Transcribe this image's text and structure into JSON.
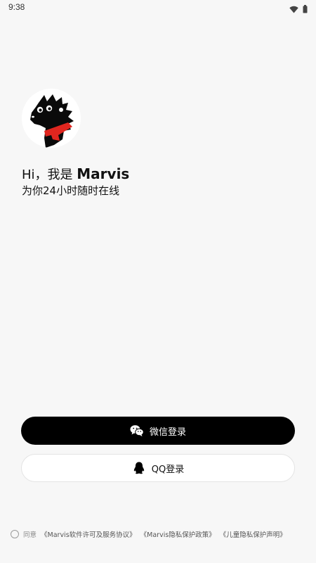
{
  "status_bar": {
    "time": "9:38",
    "icons": [
      "wifi-icon",
      "battery-icon"
    ]
  },
  "welcome": {
    "greeting_prefix": "Hi，我是 ",
    "brand": "Marvis",
    "subtitle": "为你24小时随时在线"
  },
  "login": {
    "wechat_label": "微信登录",
    "qq_label": "QQ登录"
  },
  "agreement": {
    "prefix": "同意",
    "links": [
      "《Marvis软件许可及服务协议》",
      "《Marvis隐私保护政策》",
      "《儿童隐私保护声明》"
    ]
  },
  "colors": {
    "background": "#f7f7f7",
    "wechat_button": "#000000",
    "qq_button": "#ffffff",
    "scarf": "#e0261f"
  }
}
